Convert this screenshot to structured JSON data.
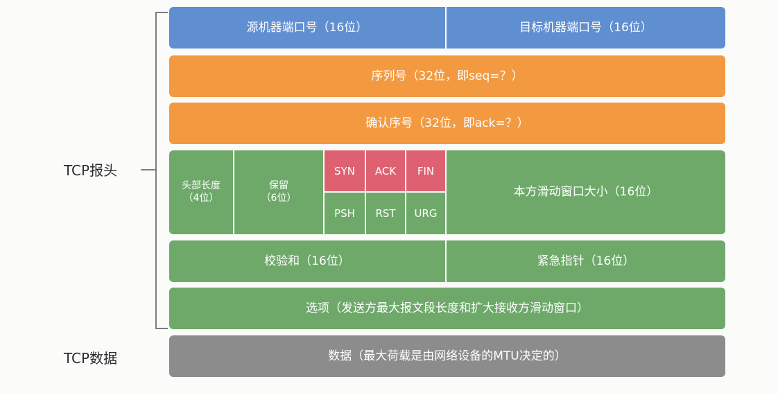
{
  "labels": {
    "header": "TCP报头",
    "data": "TCP数据"
  },
  "rows": {
    "source_port": "源机器端口号（16位）",
    "dest_port": "目标机器端口号（16位）",
    "sequence": "序列号（32位，即seq=？）",
    "ack_number": "确认序号（32位，即ack=？）",
    "header_length_line1": "头部长度",
    "header_length_line2": "（4位）",
    "reserved_line1": "保留",
    "reserved_line2": "（6位）",
    "window_size": "本方滑动窗口大小（16位）",
    "checksum": "校验和（16位）",
    "urgent_pointer": "紧急指针（16位）",
    "options": "选项（发送方最大报文段长度和扩大接收方滑动窗口）",
    "payload": "数据（最大荷载是由网络设备的MTU决定的）"
  },
  "flags": {
    "top": [
      "SYN",
      "ACK",
      "FIN"
    ],
    "bottom": [
      "PSH",
      "RST",
      "URG"
    ]
  },
  "colors": {
    "port_row": "#5f8fd0",
    "sequence_rows": "#f39a40",
    "control_rows": "#6ea96a",
    "highlight_flags": "#de6172",
    "data_row": "#8c8c8c"
  }
}
